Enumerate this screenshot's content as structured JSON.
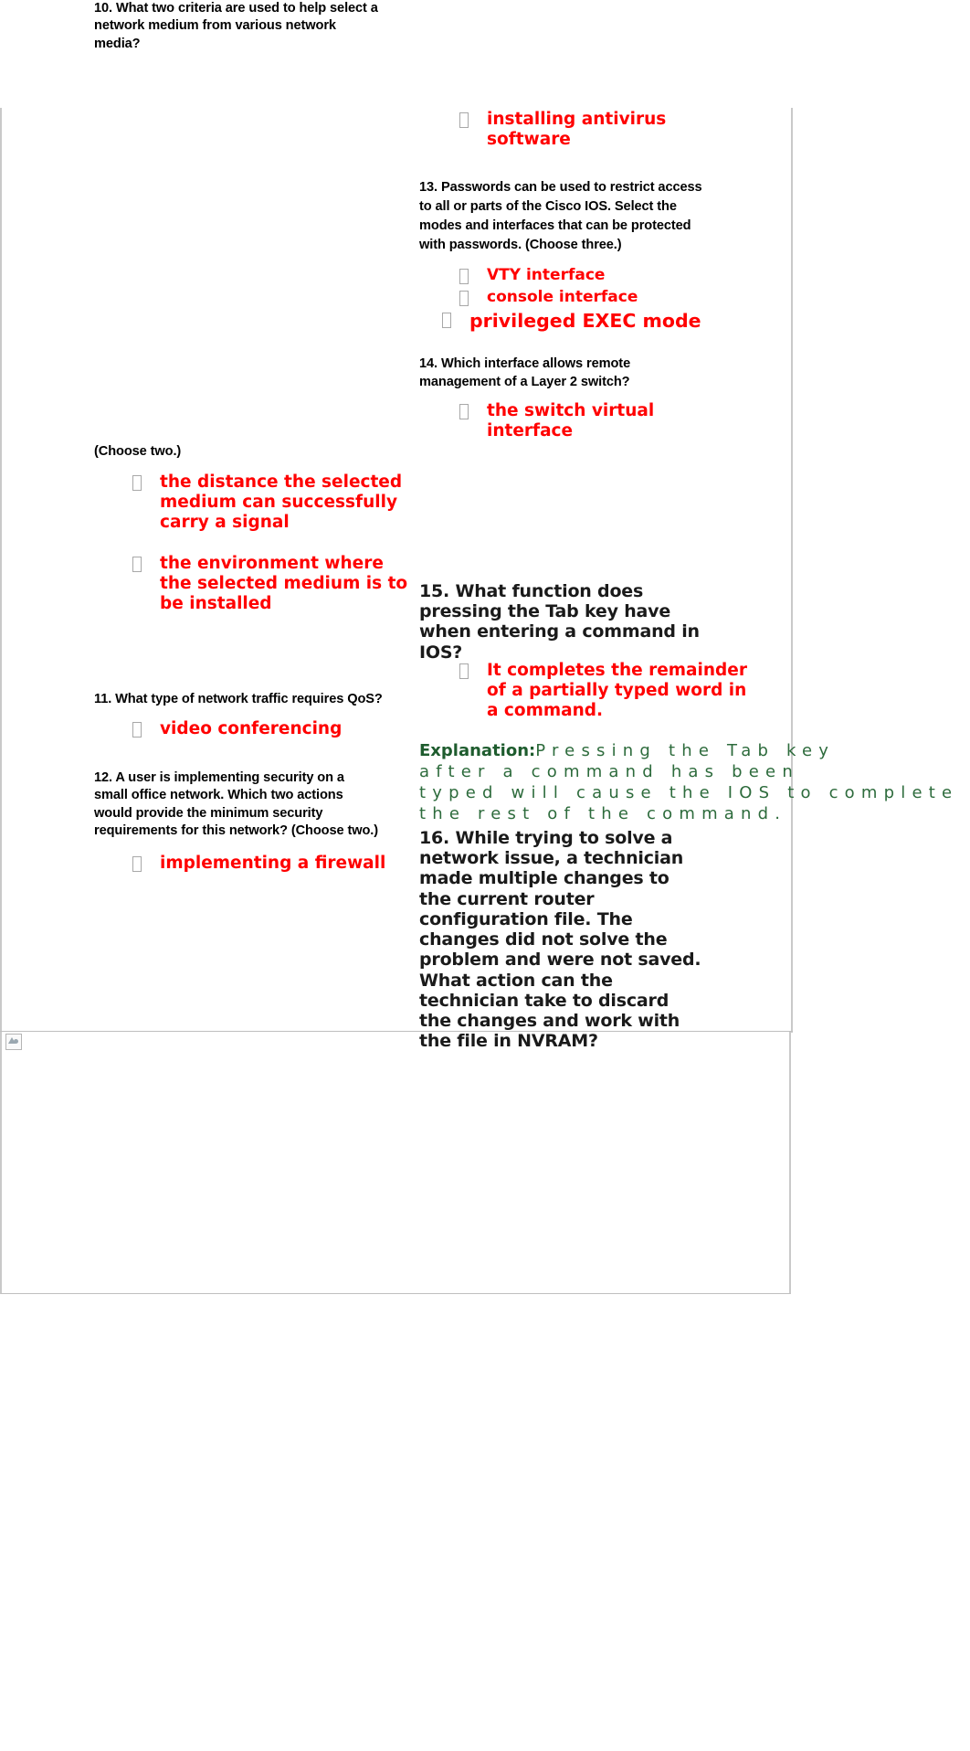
{
  "document": {
    "bullet_glyph": "box-glyph",
    "answer_color": "#ff0000",
    "explanation_color": "#1e5c2e",
    "question_color": "#000000"
  },
  "left_column": {
    "q10": {
      "text": "10. What two criteria are used to help select a network medium from various network media?",
      "continued": "(Choose two.)",
      "answers": [
        "the distance the selected medium can successfully carry a signal",
        "the environment where the selected medium is to be installed"
      ]
    },
    "q11": {
      "text": "11. What type of network traffic requires QoS?",
      "answers": [
        "video conferencing"
      ]
    },
    "q12": {
      "text": "12. A user is implementing security on a small office network. Which two actions would provide the minimum security requirements for this network? (Choose two.)",
      "answers": [
        "implementing a firewall"
      ]
    }
  },
  "right_column": {
    "q12_continued": {
      "answers": [
        "installing antivirus software"
      ]
    },
    "q13": {
      "text": "13. Passwords can be used to restrict access to all or parts of the Cisco IOS. Select the modes and interfaces that can be protected with passwords. (Choose three.)",
      "answers": [
        "VTY interface",
        "console interface",
        "privileged EXEC mode"
      ]
    },
    "q14": {
      "text": "14. Which interface allows remote management of a Layer 2 switch?",
      "answers": [
        "the switch virtual interface"
      ]
    },
    "q15": {
      "text": "15. What function does pressing the Tab key have when entering a command in IOS?",
      "answers": [
        "It completes the remainder of a partially typed word in a command."
      ],
      "explanation_label": "Explanation:",
      "explanation_lines": [
        "Pressing the Tab key",
        "after a command has been",
        "typed will cause the IOS to complete",
        "the rest of the command."
      ]
    },
    "q16": {
      "text": "16. While trying to solve a network issue, a technician made multiple changes to the current router configuration file. The changes did not solve the problem and were not saved. What action can the technician take to discard the changes and work with the file in NVRAM?"
    }
  },
  "footer": {
    "broken_image_alt": "broken-image-placeholder"
  }
}
